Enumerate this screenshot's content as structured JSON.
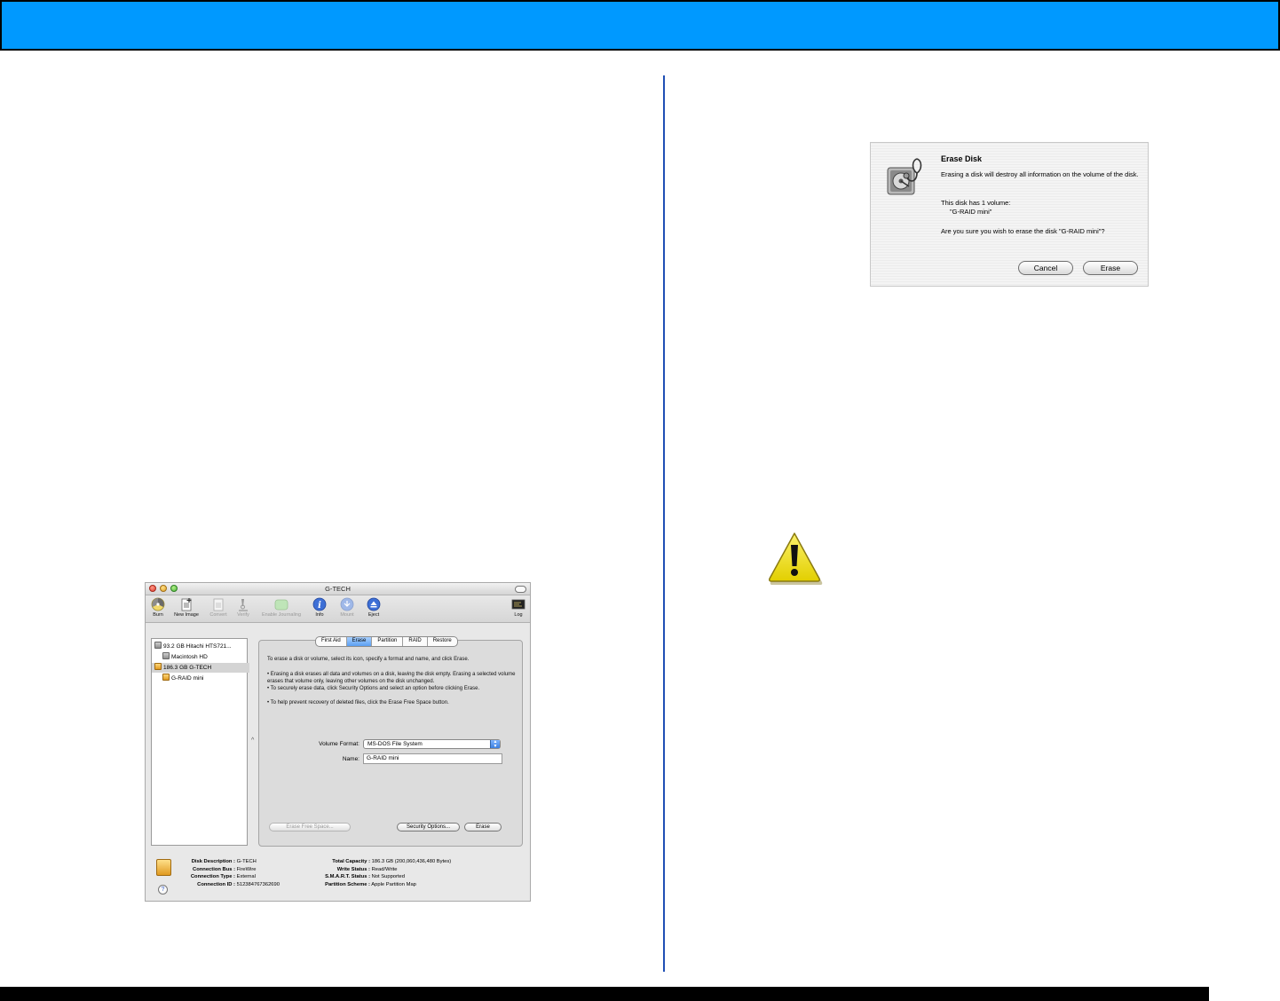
{
  "disk_utility": {
    "title": "G-TECH",
    "toolbar": [
      {
        "label": "Burn",
        "icon": "burn-icon",
        "enabled": true
      },
      {
        "label": "New Image",
        "icon": "new-image-icon",
        "enabled": true
      },
      {
        "label": "Convert",
        "icon": "convert-icon",
        "enabled": false
      },
      {
        "label": "Verify",
        "icon": "verify-icon",
        "enabled": false
      },
      {
        "label": "Enable Journaling",
        "icon": "journaling-icon",
        "enabled": false
      },
      {
        "label": "Info",
        "icon": "info-icon",
        "enabled": true
      },
      {
        "label": "Mount",
        "icon": "mount-icon",
        "enabled": false
      },
      {
        "label": "Eject",
        "icon": "eject-icon",
        "enabled": true
      },
      {
        "label": "Log",
        "icon": "log-icon",
        "enabled": true
      }
    ],
    "sidebar": [
      {
        "label": "93.2 GB Hitachi HTS721...",
        "type": "drive",
        "selected": false
      },
      {
        "label": "Macintosh HD",
        "type": "volume",
        "selected": false
      },
      {
        "label": "186.3 GB G-TECH",
        "type": "drive-external",
        "selected": true
      },
      {
        "label": "G-RAID mini",
        "type": "volume-external",
        "selected": false
      }
    ],
    "tabs": [
      {
        "label": "First Aid",
        "active": false
      },
      {
        "label": "Erase",
        "active": true
      },
      {
        "label": "Partition",
        "active": false
      },
      {
        "label": "RAID",
        "active": false
      },
      {
        "label": "Restore",
        "active": false
      }
    ],
    "instructions": "To erase a disk or volume, select its icon, specify a format and name, and click Erase.",
    "bullets": [
      "• Erasing a disk erases all data and volumes on a disk, leaving the disk empty. Erasing a selected volume erases that volume only, leaving other volumes on the disk unchanged.",
      "• To securely erase data, click Security Options and select an option before clicking Erase.",
      "• To help prevent recovery of deleted files, click the Erase Free Space button."
    ],
    "volume_format_label": "Volume Format:",
    "volume_format_value": "MS-DOS File System",
    "name_label": "Name:",
    "name_value": "G-RAID mini",
    "erase_free_space_button": "Erase Free Space...",
    "security_options_button": "Security Options...",
    "erase_button": "Erase",
    "splitter_glyph": "^",
    "help_glyph": "?",
    "info_left": [
      {
        "key": "Disk Description :",
        "value": "G-TECH"
      },
      {
        "key": "Connection Bus :",
        "value": "FireWire"
      },
      {
        "key": "Connection Type :",
        "value": "External"
      },
      {
        "key": "Connection ID :",
        "value": "512384767362690"
      }
    ],
    "info_right": [
      {
        "key": "Total Capacity :",
        "value": "186.3 GB (200,060,436,480 Bytes)"
      },
      {
        "key": "Write Status :",
        "value": "Read/Write"
      },
      {
        "key": "S.M.A.R.T. Status :",
        "value": "Not Supported"
      },
      {
        "key": "Partition Scheme :",
        "value": "Apple Partition Map"
      }
    ]
  },
  "erase_dialog": {
    "title": "Erase Disk",
    "message": "Erasing a disk will destroy all information on the volume of the disk.",
    "volume_count": "This disk has 1 volume:",
    "volume_name": "\"G-RAID mini\"",
    "question": "Are you sure you wish to erase the disk \"G-RAID mini\"?",
    "cancel_label": "Cancel",
    "erase_label": "Erase"
  },
  "colors": {
    "header_blue": "#0099ff",
    "divider_blue": "#1f4fb5",
    "warning_yellow": "#f2e600"
  }
}
